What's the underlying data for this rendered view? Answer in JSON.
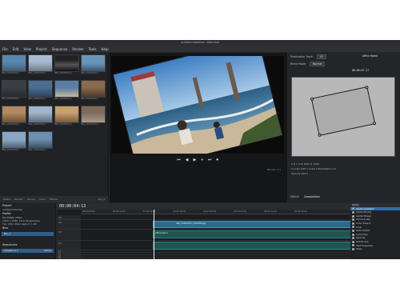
{
  "window": {
    "title": "untitled.kdenlive - Kdenlive"
  },
  "menu": [
    "File",
    "Edit",
    "View",
    "Project",
    "Sequence",
    "Render",
    "Tools",
    "Help"
  ],
  "bin": {
    "thumbs": [
      {
        "caption": "IMG_20160709_1"
      },
      {
        "caption": "IMG_20160709_1"
      },
      {
        "caption": "IMG_20160709_1"
      },
      {
        "caption": "IMG_20160709_1"
      },
      {
        "caption": "IMG_20160709_1"
      },
      {
        "caption": "IMG_20160709_1"
      },
      {
        "caption": "IMG_20160709_1"
      },
      {
        "caption": "IMG_20160709_1"
      },
      {
        "caption": "IMG_20160709_1"
      },
      {
        "caption": "IMG_20160709_1"
      },
      {
        "caption": "IMG_20160709_1"
      },
      {
        "caption": "IMG_20160709_1"
      },
      {
        "caption": "IMG_20160709_1"
      },
      {
        "caption": "IMG_20160709_1"
      }
    ],
    "footer": [
      "Media",
      "Render",
      "Library",
      "Undo",
      "Effects"
    ],
    "count": "Bin_1"
  },
  "viewer": {
    "controls": [
      "⏮",
      "◀",
      "▶",
      "⏸",
      "⏭",
      "⏺"
    ],
    "zoom": "Monitor 1:1"
  },
  "effect": {
    "header": "Affine Blend",
    "destination_label": "Destination Track:",
    "destination_value": "V2",
    "blend_label": "Blend Mode:",
    "blend_value": "Normal",
    "timecode": "00:00:07:17",
    "geom_line1": "X 0  Y 0  W 1920  H 1080",
    "geom_line2": "X scale 0.80  Y scale 0.80  Rotation 15",
    "geom_line3": "Opacity 100%",
    "tabs": [
      "Effects",
      "Composition"
    ]
  },
  "project": {
    "title": "Project",
    "name": "untitled.kdenlive",
    "profile_label": "Profile",
    "profile_lines": [
      "HD 1080p 25fps",
      "1920 x 1080, 16:9, Progressive",
      "Fps: 25/1, Pixel Aspect: 1.00"
    ],
    "bins_label": "Bins",
    "bin_name": "Bin_1",
    "sequences_label": "Sequences",
    "sequence_name": "Sequence 1",
    "sequence_badge": "active"
  },
  "timeline": {
    "timecode": "00:00:04:13",
    "ruler": [
      "00:00:00:00",
      "00:00:02:00",
      "00:00:04:00",
      "00:00:06:00",
      "00:00:08:00",
      "00:00:10:00",
      "00:00:12:00",
      "00:00:14:00"
    ],
    "tracks": [
      {
        "name": "V4"
      },
      {
        "name": "V3"
      },
      {
        "name": "V2"
      },
      {
        "name": "V1"
      },
      {
        "name": "A1"
      },
      {
        "name": "A2"
      },
      {
        "name": "A3"
      },
      {
        "name": "A4"
      }
    ],
    "clip_label": "IMG_20160709_1343456.jpg",
    "comp_label": "affine blend"
  },
  "fxlist": {
    "header": "Alpha",
    "items": [
      "Alpha Gradient",
      "Alpha Modify",
      "Alpha Shape",
      "Chroma Key",
      "Color Select",
      "Crop",
      "Fade In/Out",
      "Luma Key",
      "Opacity",
      "Rotoscope",
      "Spill Suppress",
      "Wipe"
    ]
  }
}
